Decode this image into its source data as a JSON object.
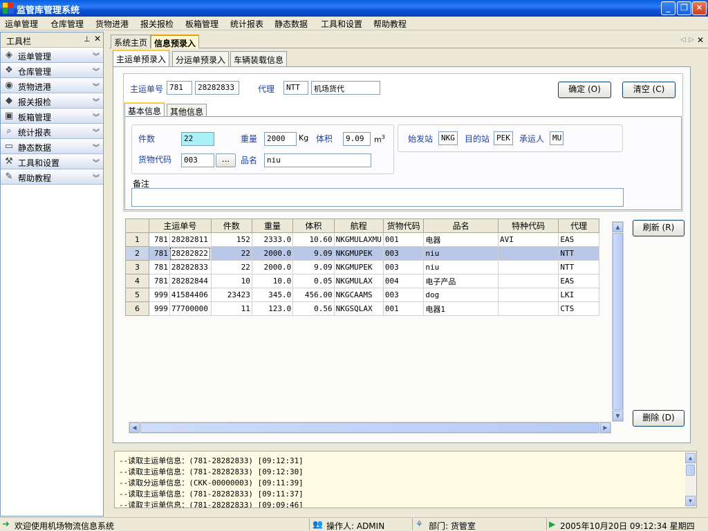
{
  "window": {
    "title": "监管库管理系统"
  },
  "menu": [
    "运单管理",
    "仓库管理",
    "货物进港",
    "报关报检",
    "板箱管理",
    "统计报表",
    "静态数据",
    "工具和设置",
    "帮助教程"
  ],
  "toolbar_panel": {
    "title": "工具栏",
    "items": [
      {
        "label": "运单管理",
        "icon": "waybill-icon"
      },
      {
        "label": "仓库管理",
        "icon": "warehouse-icon"
      },
      {
        "label": "货物进港",
        "icon": "cargo-in-icon"
      },
      {
        "label": "报关报检",
        "icon": "customs-icon"
      },
      {
        "label": "板箱管理",
        "icon": "pallet-icon"
      },
      {
        "label": "统计报表",
        "icon": "report-icon"
      },
      {
        "label": "静态数据",
        "icon": "data-icon"
      },
      {
        "label": "工具和设置",
        "icon": "tools-icon"
      },
      {
        "label": "帮助教程",
        "icon": "help-icon"
      }
    ]
  },
  "doc_tabs": [
    "系统主页",
    "信息预录入"
  ],
  "inner_tabs": [
    "主运单预录入",
    "分运单预录入",
    "车辆装载信息"
  ],
  "form": {
    "master_no_label": "主运单号",
    "master_prefix": "781",
    "master_number": "28282833",
    "agent_label": "代理",
    "agent_code": "NTT",
    "agent_name": "机场货代",
    "confirm_label": "确定 (O)",
    "clear_label": "清空 (C)",
    "sub_tabs": [
      "基本信息",
      "其他信息"
    ],
    "pieces_label": "件数",
    "pieces": "22",
    "weight_label": "重量",
    "weight": "2000",
    "weight_unit": "Kg",
    "volume_label": "体积",
    "volume": "9.09",
    "volume_unit": "m",
    "volume_unit_sup": "3",
    "cargo_code_label": "货物代码",
    "cargo_code": "003",
    "browse_label": "...",
    "product_label": "品名",
    "product": "niu",
    "origin_label": "始发站",
    "origin": "NKG",
    "dest_label": "目的站",
    "dest": "PEK",
    "carrier_label": "承运人",
    "carrier": "MU",
    "remark_label": "备注",
    "remark": ""
  },
  "grid": {
    "columns": [
      "主运单号",
      "件数",
      "重量",
      "体积",
      "航程",
      "货物代码",
      "品名",
      "特种代码",
      "代理"
    ],
    "rows": [
      {
        "rownum": "1",
        "prefix": "781",
        "no": "28282811",
        "pieces": "152",
        "weight": "2333.0",
        "volume": "10.60",
        "route": "NKGMULAXMU",
        "code": "001",
        "product": "电器",
        "special": "AVI",
        "agent": "EAS"
      },
      {
        "rownum": "2",
        "prefix": "781",
        "no": "28282822",
        "pieces": "22",
        "weight": "2000.0",
        "volume": "9.09",
        "route": "NKGMUPEK",
        "code": "003",
        "product": "niu",
        "special": "",
        "agent": "NTT"
      },
      {
        "rownum": "3",
        "prefix": "781",
        "no": "28282833",
        "pieces": "22",
        "weight": "2000.0",
        "volume": "9.09",
        "route": "NKGMUPEK",
        "code": "003",
        "product": "niu",
        "special": "",
        "agent": "NTT"
      },
      {
        "rownum": "4",
        "prefix": "781",
        "no": "28282844",
        "pieces": "10",
        "weight": "10.0",
        "volume": "0.05",
        "route": "NKGMULAX",
        "code": "004",
        "product": "电子产品",
        "special": "",
        "agent": "EAS"
      },
      {
        "rownum": "5",
        "prefix": "999",
        "no": "41584406",
        "pieces": "23423",
        "weight": "345.0",
        "volume": "456.00",
        "route": "NKGCAAMS",
        "code": "003",
        "product": "dog",
        "special": "",
        "agent": "LKI"
      },
      {
        "rownum": "6",
        "prefix": "999",
        "no": "77700000",
        "pieces": "11",
        "weight": "123.0",
        "volume": "0.56",
        "route": "NKGSQLAX",
        "code": "001",
        "product": "电器1",
        "special": "",
        "agent": "CTS"
      }
    ],
    "refresh_label": "刷新 (R)",
    "delete_label": "删除 (D)"
  },
  "log": [
    "--读取主运单信息：(781-28282833) [09:12:31]",
    "--读取主运单信息：(781-28282833) [09:12:30]",
    "--读取分运单信息：(CKK-00000003) [09:11:39]",
    "--读取主运单信息：(781-28282833) [09:11:37]",
    "--读取主运单信息：(781-28282833) [09:09:46]"
  ],
  "status": {
    "welcome": "欢迎使用机场物流信息系统",
    "operator": "操作人: ADMIN",
    "department": "部门: 货管室",
    "datetime": "2005年10月20日 09:12:34 星期四"
  }
}
